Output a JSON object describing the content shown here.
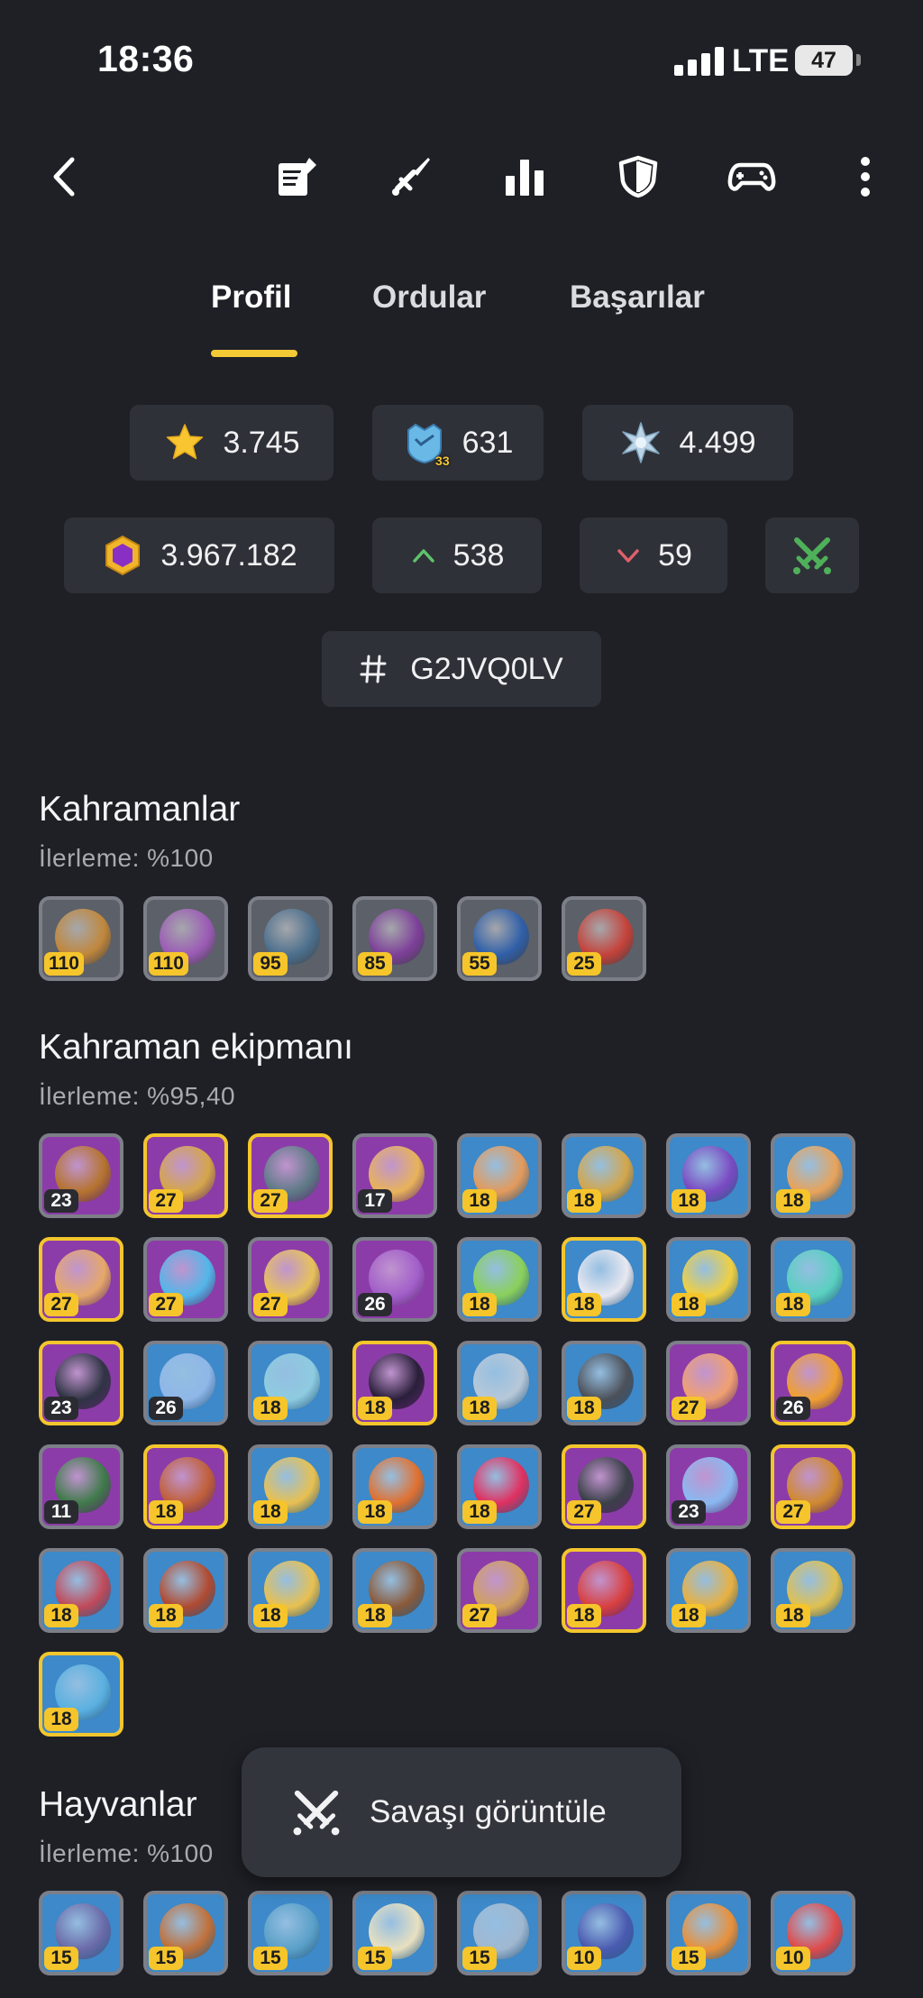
{
  "status_bar": {
    "time": "18:36",
    "network": "LTE",
    "battery": "47"
  },
  "tabs": [
    {
      "label": "Profil",
      "active": true
    },
    {
      "label": "Ordular",
      "active": false
    },
    {
      "label": "Başarılar",
      "active": false
    }
  ],
  "stats": {
    "trophies": "3.745",
    "builder_base_trophies": "631",
    "builder_base_badge_level": "33",
    "capital_trophies": "4.499",
    "clan_capital_contributions": "3.967.182",
    "donated": "538",
    "received": "59",
    "player_tag": "G2JVQ0LV"
  },
  "sections": {
    "heroes": {
      "title": "Kahramanlar",
      "progress": "İlerleme: %100",
      "items": [
        {
          "level": "110",
          "badge": "yellow",
          "bg": "hero",
          "art": "#c0873c"
        },
        {
          "level": "110",
          "badge": "yellow",
          "bg": "hero",
          "art": "#9b5bb5"
        },
        {
          "level": "95",
          "badge": "yellow",
          "bg": "hero",
          "art": "#4c6f8d"
        },
        {
          "level": "85",
          "badge": "yellow",
          "bg": "hero",
          "art": "#7d3f99"
        },
        {
          "level": "55",
          "badge": "yellow",
          "bg": "hero",
          "art": "#2f5fa8"
        },
        {
          "level": "25",
          "badge": "yellow",
          "bg": "hero",
          "art": "#c4423a"
        }
      ]
    },
    "equipment": {
      "title": "Kahraman ekipmanı",
      "progress": "İlerleme: %95,40",
      "items": [
        {
          "level": "23",
          "badge": "dark",
          "bg": "purple",
          "border": "grey",
          "art": "#b5732e"
        },
        {
          "level": "27",
          "badge": "yellow",
          "bg": "purple",
          "border": "gold",
          "art": "#d5a64a"
        },
        {
          "level": "27",
          "badge": "yellow",
          "bg": "purple",
          "border": "gold",
          "art": "#5e7a86"
        },
        {
          "level": "17",
          "badge": "dark",
          "bg": "purple",
          "border": "grey",
          "art": "#e8b35a"
        },
        {
          "level": "18",
          "badge": "yellow",
          "bg": "blue",
          "border": "grey",
          "art": "#e39a5b"
        },
        {
          "level": "18",
          "badge": "yellow",
          "bg": "blue",
          "border": "grey",
          "art": "#d4a64a"
        },
        {
          "level": "18",
          "badge": "yellow",
          "bg": "blue",
          "border": "grey",
          "art": "#7a4ac2"
        },
        {
          "level": "18",
          "badge": "yellow",
          "bg": "blue",
          "border": "grey",
          "art": "#e8a35a"
        },
        {
          "level": "27",
          "badge": "yellow",
          "bg": "purple",
          "border": "gold",
          "art": "#e5a86a"
        },
        {
          "level": "27",
          "badge": "yellow",
          "bg": "purple",
          "border": "grey",
          "art": "#53b6e8"
        },
        {
          "level": "27",
          "badge": "yellow",
          "bg": "purple",
          "border": "grey",
          "art": "#e7c35a"
        },
        {
          "level": "26",
          "badge": "dark",
          "bg": "purple",
          "border": "grey",
          "art": "#a25fc9"
        },
        {
          "level": "18",
          "badge": "yellow",
          "bg": "blue",
          "border": "grey",
          "art": "#8ad05a"
        },
        {
          "level": "18",
          "badge": "yellow",
          "bg": "blue",
          "border": "gold",
          "art": "#e8e8f0"
        },
        {
          "level": "18",
          "badge": "yellow",
          "bg": "blue",
          "border": "grey",
          "art": "#f0d040"
        },
        {
          "level": "18",
          "badge": "yellow",
          "bg": "blue",
          "border": "grey",
          "art": "#5ad0c0"
        },
        {
          "level": "23",
          "badge": "dark",
          "bg": "purple",
          "border": "gold",
          "art": "#2f3444"
        },
        {
          "level": "26",
          "badge": "dark",
          "bg": "blue",
          "border": "grey",
          "art": "#8fb7e8"
        },
        {
          "level": "18",
          "badge": "yellow",
          "bg": "blue",
          "border": "grey",
          "art": "#8ecbe0"
        },
        {
          "level": "18",
          "badge": "yellow",
          "bg": "purple",
          "border": "gold",
          "art": "#2a1f3a"
        },
        {
          "level": "18",
          "badge": "yellow",
          "bg": "blue",
          "border": "grey",
          "art": "#b7c8d8"
        },
        {
          "level": "18",
          "badge": "yellow",
          "bg": "blue",
          "border": "grey",
          "art": "#4c5058"
        },
        {
          "level": "27",
          "badge": "yellow",
          "bg": "purple",
          "border": "grey",
          "art": "#f0a070"
        },
        {
          "level": "26",
          "badge": "dark",
          "bg": "purple",
          "border": "gold",
          "art": "#f0a030"
        },
        {
          "level": "11",
          "badge": "dark",
          "bg": "purple",
          "border": "grey",
          "art": "#3f7a4a"
        },
        {
          "level": "18",
          "badge": "yellow",
          "bg": "purple",
          "border": "gold",
          "art": "#c0603a"
        },
        {
          "level": "18",
          "badge": "yellow",
          "bg": "blue",
          "border": "grey",
          "art": "#e8c050"
        },
        {
          "level": "18",
          "badge": "yellow",
          "bg": "blue",
          "border": "grey",
          "art": "#e07030"
        },
        {
          "level": "18",
          "badge": "yellow",
          "bg": "blue",
          "border": "grey",
          "art": "#e03060"
        },
        {
          "level": "27",
          "badge": "yellow",
          "bg": "purple",
          "border": "gold",
          "art": "#3a4048"
        },
        {
          "level": "23",
          "badge": "dark",
          "bg": "purple",
          "border": "grey",
          "art": "#8ab8f0"
        },
        {
          "level": "27",
          "badge": "yellow",
          "bg": "purple",
          "border": "gold",
          "art": "#d08a30"
        },
        {
          "level": "18",
          "badge": "yellow",
          "bg": "blue",
          "border": "grey",
          "art": "#c04a5a"
        },
        {
          "level": "18",
          "badge": "yellow",
          "bg": "blue",
          "border": "grey",
          "art": "#b04a30"
        },
        {
          "level": "18",
          "badge": "yellow",
          "bg": "blue",
          "border": "grey",
          "art": "#e8c050"
        },
        {
          "level": "18",
          "badge": "yellow",
          "bg": "blue",
          "border": "grey",
          "art": "#8a5a3a"
        },
        {
          "level": "27",
          "badge": "yellow",
          "bg": "purple",
          "border": "grey",
          "art": "#d0a060"
        },
        {
          "level": "18",
          "badge": "yellow",
          "bg": "purple",
          "border": "gold",
          "art": "#d84040"
        },
        {
          "level": "18",
          "badge": "yellow",
          "bg": "blue",
          "border": "grey",
          "art": "#e8b040"
        },
        {
          "level": "18",
          "badge": "yellow",
          "bg": "blue",
          "border": "grey",
          "art": "#e0c050"
        },
        {
          "level": "18",
          "badge": "yellow",
          "bg": "blue",
          "border": "gold",
          "art": "#5ab0e0"
        }
      ]
    },
    "pets": {
      "title": "Hayvanlar",
      "progress": "İlerleme: %100",
      "items": [
        {
          "level": "15",
          "badge": "yellow",
          "bg": "blue",
          "border": "grey",
          "art": "#6a6aa8"
        },
        {
          "level": "15",
          "badge": "yellow",
          "bg": "blue",
          "border": "grey",
          "art": "#c0703a"
        },
        {
          "level": "15",
          "badge": "yellow",
          "bg": "blue",
          "border": "grey",
          "art": "#5aa0c8"
        },
        {
          "level": "15",
          "badge": "yellow",
          "bg": "blue",
          "border": "grey",
          "art": "#e8e0c0"
        },
        {
          "level": "15",
          "badge": "yellow",
          "bg": "blue",
          "border": "grey",
          "art": "#a0b8d0"
        },
        {
          "level": "10",
          "badge": "yellow",
          "bg": "blue",
          "border": "grey",
          "art": "#4a5ab0"
        },
        {
          "level": "15",
          "badge": "yellow",
          "bg": "blue",
          "border": "grey",
          "art": "#e8903a"
        },
        {
          "level": "10",
          "badge": "yellow",
          "bg": "blue",
          "border": "grey",
          "art": "#e04a4a"
        }
      ]
    }
  },
  "snackbar": {
    "label": "Savaşı görüntüle"
  },
  "colors": {
    "accent": "#f3c935",
    "background": "#1f2026",
    "chip": "#2f3138",
    "up": "#5ec46a",
    "down": "#e0606a",
    "sword": "#4fb05a"
  },
  "icons": [
    "back-arrow-icon",
    "notes-icon",
    "sword-icon",
    "bar-chart-icon",
    "shield-icon",
    "gamepad-icon",
    "more-vertical-icon",
    "star-icon",
    "builder-badge-icon",
    "capital-icon",
    "gem-icon",
    "arrow-up-icon",
    "arrow-down-icon",
    "crossed-swords-icon",
    "hash-icon"
  ]
}
